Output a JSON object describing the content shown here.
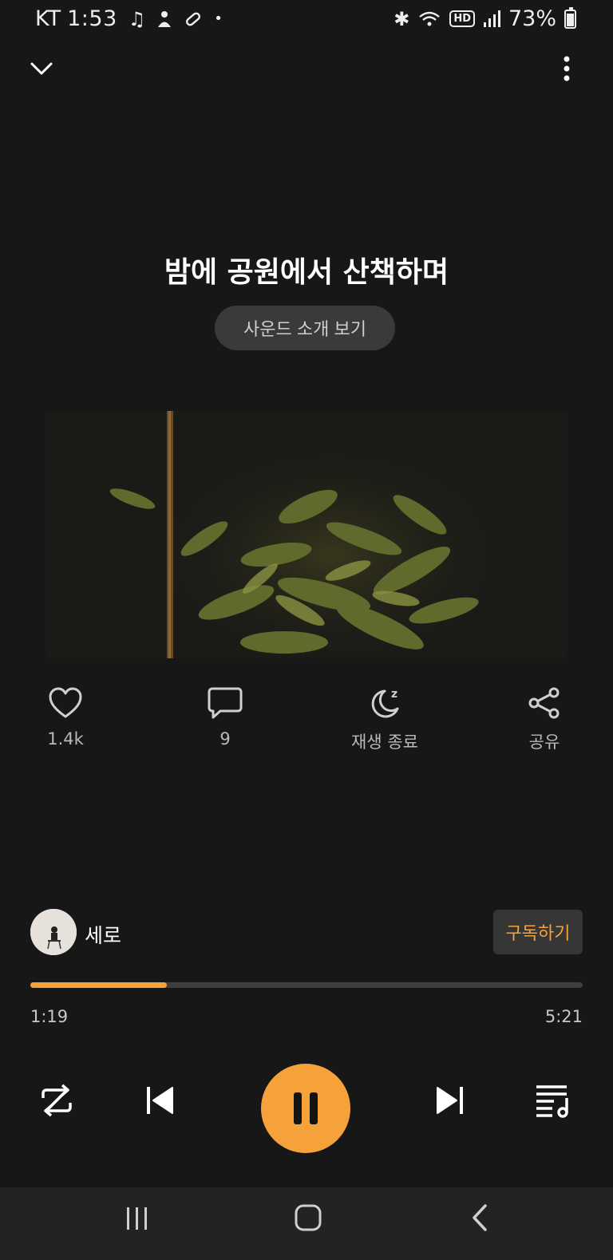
{
  "status_bar": {
    "carrier": "KT",
    "time": "1:53",
    "battery": "73%"
  },
  "header": {
    "collapse_icon": "chevron-down-icon",
    "menu_icon": "more-vert-icon"
  },
  "track": {
    "title": "밤에 공원에서 산책하며",
    "intro_button_label": "사운드 소개 보기"
  },
  "actions": [
    {
      "icon": "heart-icon",
      "label": "1.4k"
    },
    {
      "icon": "comment-icon",
      "label": "9"
    },
    {
      "icon": "sleep-timer-icon",
      "label": "재생 종료"
    },
    {
      "icon": "share-icon",
      "label": "공유"
    }
  ],
  "creator": {
    "name": "세로",
    "subscribe_label": "구독하기"
  },
  "playback": {
    "elapsed": "1:19",
    "total": "5:21",
    "progress_fraction": 0.247
  },
  "colors": {
    "accent": "#f5a23b",
    "background": "#171717"
  }
}
